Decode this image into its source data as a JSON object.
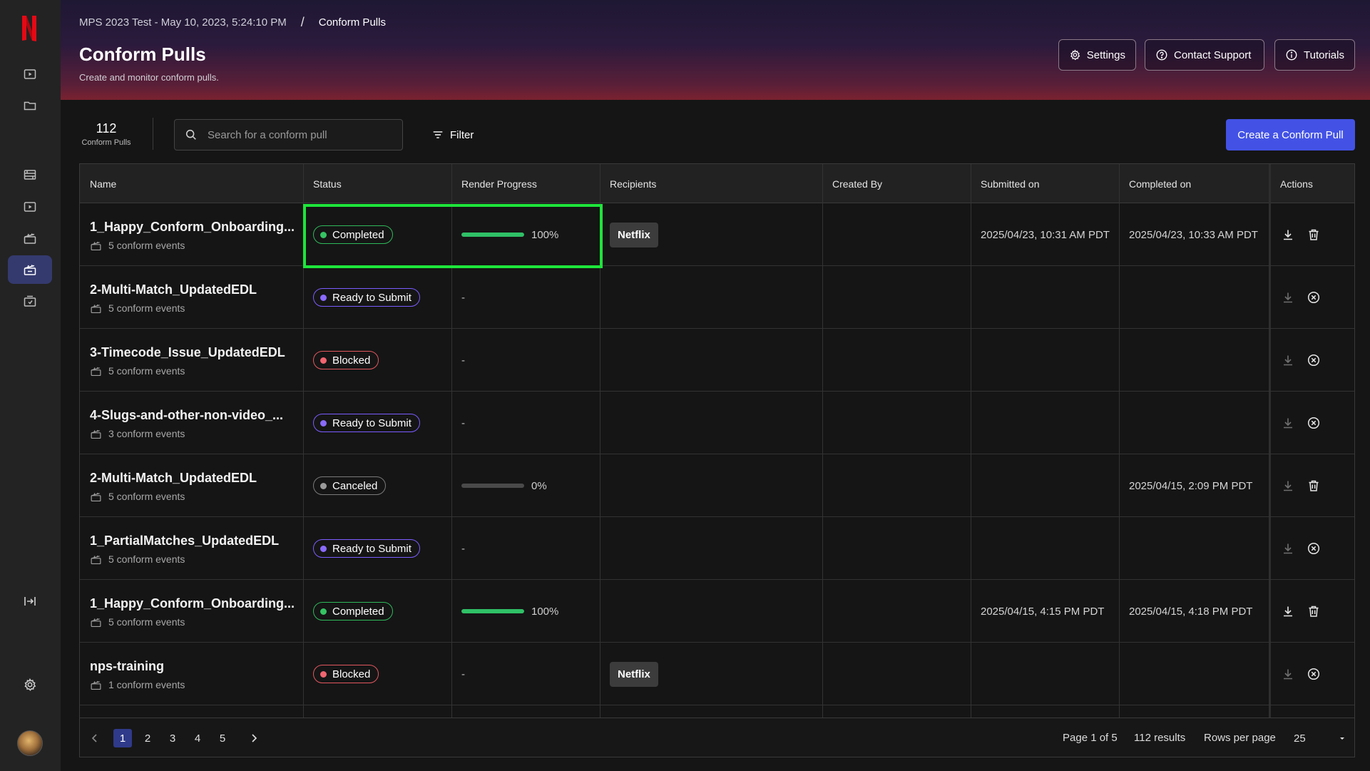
{
  "app": {
    "brand_letter": "N",
    "accent": "#e50914"
  },
  "header": {
    "breadcrumb_project": "MPS 2023 Test - May 10, 2023, 5:24:10 PM",
    "breadcrumb_separator": "/",
    "breadcrumb_current": "Conform Pulls",
    "title": "Conform Pulls",
    "subtitle": "Create and monitor conform pulls.",
    "settings_label": "Settings",
    "support_label": "Contact Support",
    "tutorials_label": "Tutorials"
  },
  "toolbar": {
    "count": "112",
    "count_label": "Conform Pulls",
    "search_placeholder": "Search for a conform pull",
    "filter_label": "Filter",
    "create_label": "Create a Conform Pull"
  },
  "table": {
    "columns": [
      "Name",
      "Status",
      "Render Progress",
      "Recipients",
      "Created By",
      "Submitted on",
      "Completed on",
      "Actions"
    ],
    "rows": [
      {
        "name": "1_Happy_Conform_Onboarding...",
        "events": "5 conform events",
        "status": "Completed",
        "status_color": "green",
        "progress_value": 100,
        "progress_label": "100%",
        "recipient": "Netflix",
        "created_by": "",
        "submitted": "2025/04/23, 10:31 AM PDT",
        "completed": "2025/04/23, 10:33 AM PDT",
        "secondary_action": "delete",
        "download_enabled": true
      },
      {
        "name": "2-Multi-Match_UpdatedEDL",
        "events": "5 conform events",
        "status": "Ready to Submit",
        "status_color": "purple",
        "progress_label": "-",
        "recipient": "",
        "created_by": "",
        "submitted": "",
        "completed": "",
        "secondary_action": "cancel",
        "download_enabled": false
      },
      {
        "name": "3-Timecode_Issue_UpdatedEDL",
        "events": "5 conform events",
        "status": "Blocked",
        "status_color": "red",
        "progress_label": "-",
        "recipient": "",
        "created_by": "",
        "submitted": "",
        "completed": "",
        "secondary_action": "cancel",
        "download_enabled": false
      },
      {
        "name": "4-Slugs-and-other-non-video_...",
        "events": "3 conform events",
        "status": "Ready to Submit",
        "status_color": "purple",
        "progress_label": "-",
        "recipient": "",
        "created_by": "",
        "submitted": "",
        "completed": "",
        "secondary_action": "cancel",
        "download_enabled": false
      },
      {
        "name": "2-Multi-Match_UpdatedEDL",
        "events": "5 conform events",
        "status": "Canceled",
        "status_color": "grey",
        "progress_value": 0,
        "progress_label": "0%",
        "recipient": "",
        "created_by": "",
        "submitted": "",
        "completed": "2025/04/15, 2:09 PM PDT",
        "secondary_action": "delete",
        "download_enabled": false
      },
      {
        "name": "1_PartialMatches_UpdatedEDL",
        "events": "5 conform events",
        "status": "Ready to Submit",
        "status_color": "purple",
        "progress_label": "-",
        "recipient": "",
        "created_by": "",
        "submitted": "",
        "completed": "",
        "secondary_action": "cancel",
        "download_enabled": false
      },
      {
        "name": "1_Happy_Conform_Onboarding...",
        "events": "5 conform events",
        "status": "Completed",
        "status_color": "green",
        "progress_value": 100,
        "progress_label": "100%",
        "recipient": "",
        "created_by": "",
        "submitted": "2025/04/15, 4:15 PM PDT",
        "completed": "2025/04/15, 4:18 PM PDT",
        "secondary_action": "delete",
        "download_enabled": true
      },
      {
        "name": "nps-training",
        "events": "1 conform events",
        "status": "Blocked",
        "status_color": "red",
        "progress_label": "-",
        "recipient": "Netflix",
        "created_by": "",
        "submitted": "",
        "completed": "",
        "secondary_action": "cancel",
        "download_enabled": false
      }
    ]
  },
  "pagination": {
    "pages": [
      "1",
      "2",
      "3",
      "4",
      "5"
    ],
    "current_page": "1",
    "page_info": "Page 1 of 5",
    "results": "112 results",
    "rows_per_page_label": "Rows per page",
    "rows_per_page": "25"
  },
  "status_colors": {
    "green": "#35c463",
    "purple": "#8a6bff",
    "red": "#f16570",
    "grey": "#9a9a9a"
  }
}
